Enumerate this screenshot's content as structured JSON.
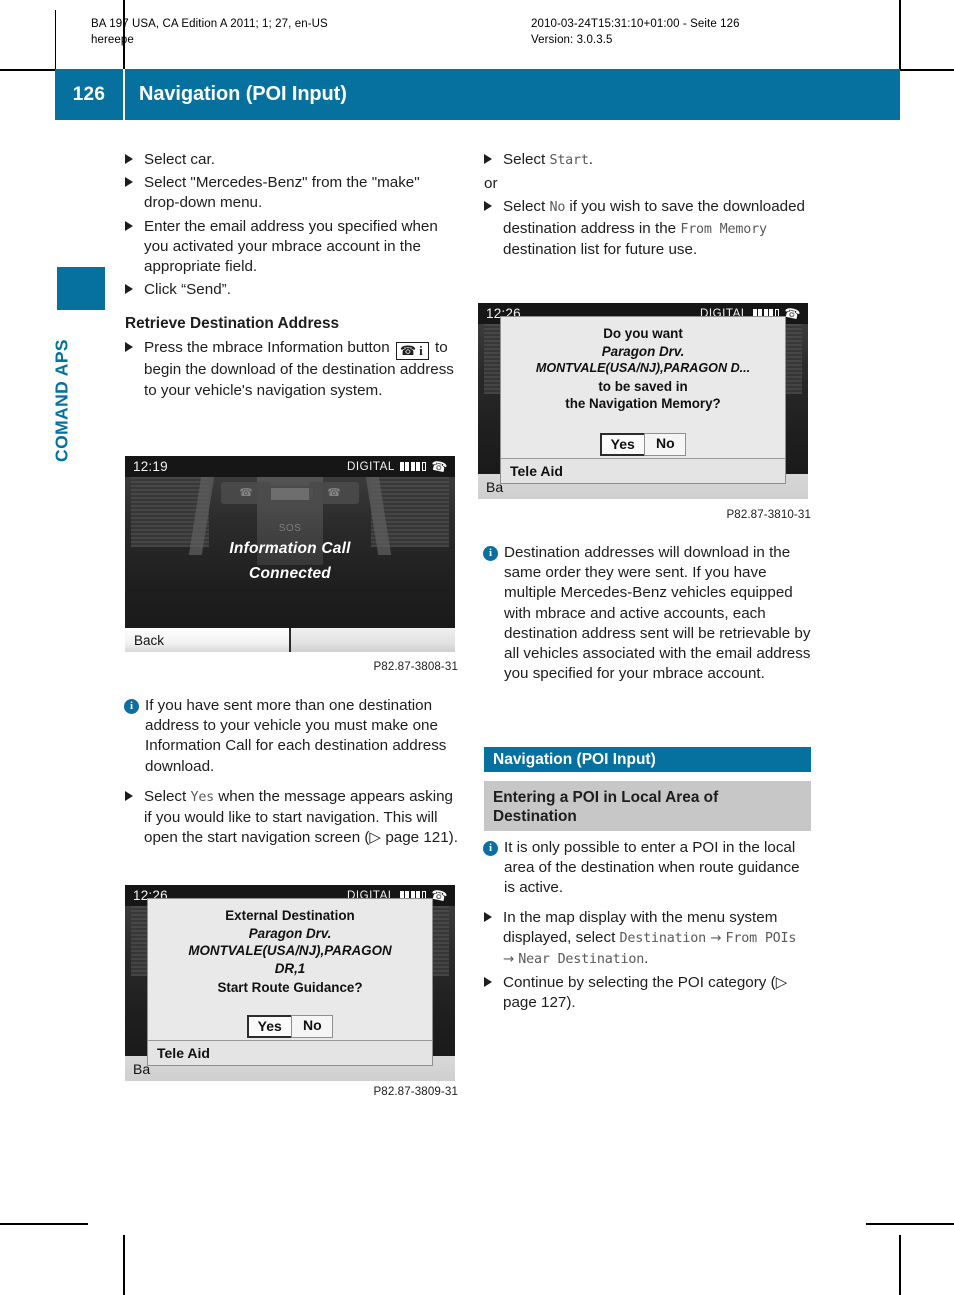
{
  "runhead": {
    "left_line1": "BA 197 USA, CA Edition A 2011; 1; 27, en-US",
    "left_line2": "hereepe",
    "right_line1": "2010-03-24T15:31:10+01:00 - Seite 126",
    "right_line2": "Version: 3.0.3.5"
  },
  "header": {
    "page_number": "126",
    "title": "Navigation (POI Input)"
  },
  "chapter_tab": {
    "label": "COMAND APS"
  },
  "left_column": {
    "steps": [
      "Select car.",
      "Select \"Mercedes-Benz\" from the \"make\" drop-down menu.",
      "Enter the email address you specified when you activated your mbrace account in the appropriate field.",
      "Click “Send”."
    ],
    "heading": "Retrieve Destination Address",
    "step_mbrace_pre": "Press the mbrace Information button",
    "step_mbrace_post": "to begin the download of the destination address to your vehicle's navigation system.",
    "mbrace_button_icon": "phone-info-button-icon",
    "figure1_caption": "P82.87-3808-31",
    "note1": "If you have sent more than one destination address to your vehicle you must make one Information Call for each destination address download.",
    "step_yes_pre": "Select",
    "step_yes_code": "Yes",
    "step_yes_post": "when the message appears asking if you would like to start navigation. This will open the start navigation screen",
    "step_yes_ref": "(▷ page 121).",
    "figure2_caption": "P82.87-3809-31"
  },
  "right_column": {
    "step_start_pre": "Select",
    "step_start_code": "Start",
    "step_start_post": ".",
    "or_label": "or",
    "step_no_pre": "Select",
    "step_no_code": "No",
    "step_no_mid": "if you wish to save the downloaded destination address in the",
    "step_no_code2": "From Memory",
    "step_no_post": "destination list for future use.",
    "figure3_caption": "P82.87-3810-31",
    "note2": "Destination addresses will download in the same order they were sent. If you have multiple Mercedes-Benz vehicles equipped with mbrace and active accounts, each destination address sent will be retrievable by all vehicles associated with the email address you specified for your mbrace account.",
    "section_title": "Navigation (POI Input)",
    "subsection_title": "Entering a POI in Local Area of Destination",
    "note3": "It is only possible to enter a POI in the local area of the destination when route guidance is active.",
    "step_map_pre": "In the map display with the menu system displayed, select",
    "step_map_code1": "Destination",
    "step_map_arrow1": "→",
    "step_map_code2": "From POIs",
    "step_map_arrow2": "→",
    "step_map_code3": "Near Destination",
    "step_map_post": ".",
    "step_continue": "Continue by selecting the POI category",
    "step_continue_ref": "(▷ page 127)."
  },
  "screens": {
    "screen1": {
      "clock": "12:19",
      "digital_label": "DIGITAL",
      "signal_bars_filled": 4,
      "signal_bars_total": 5,
      "phone_icon": "handset-icon",
      "message_line1": "Information Call",
      "message_line2": "Connected",
      "softkey_back": "Back",
      "sos_label": "SOS"
    },
    "screen2": {
      "clock": "12:26",
      "digital_label": "DIGITAL",
      "signal_bars_filled": 4,
      "signal_bars_total": 5,
      "phone_icon": "handset-icon",
      "dialog_title": "External Destination",
      "dialog_line2": "Paragon Drv.",
      "dialog_line3": "MONTVALE(USA/NJ),PARAGON",
      "dialog_line4": "DR,1",
      "dialog_line5": "Start Route Guidance?",
      "btn_yes": "Yes",
      "btn_no": "No",
      "footer": "Tele Aid",
      "back_peek": "Ba"
    },
    "screen3": {
      "clock": "12:26",
      "digital_label": "DIGITAL",
      "signal_bars_filled": 4,
      "signal_bars_total": 5,
      "phone_icon": "handset-icon",
      "dialog_title": "Do you want",
      "dialog_line2": "Paragon Drv.",
      "dialog_line3": "MONTVALE(USA/NJ),PARAGON D...",
      "dialog_line4": "to be saved in",
      "dialog_line5": "the Navigation Memory?",
      "btn_yes": "Yes",
      "btn_no": "No",
      "footer": "Tele Aid",
      "back_peek": "Ba"
    }
  },
  "colors": {
    "brand_blue": "#06709f",
    "subsection_grey": "#c7c7c7",
    "code_grey": "#5a5a5a"
  }
}
